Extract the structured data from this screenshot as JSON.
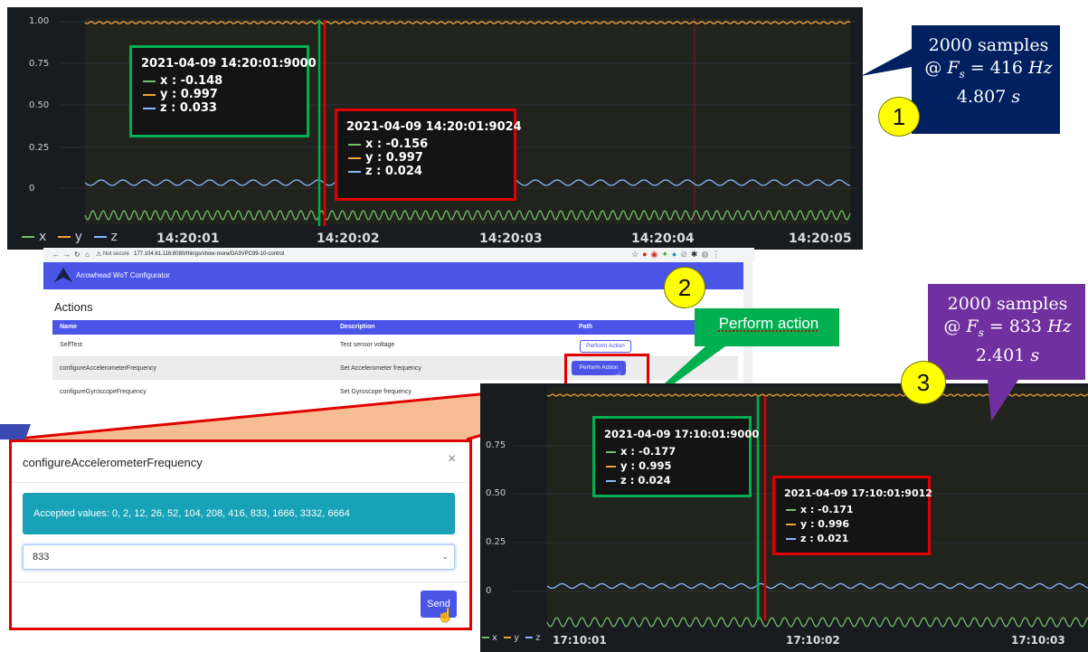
{
  "chart1": {
    "y_ticks": [
      "1.00",
      "0.75",
      "0.50",
      "0.25",
      "0"
    ],
    "x_ticks": [
      "14:20:01",
      "14:20:02",
      "14:20:03",
      "14:20:04",
      "14:20:05"
    ],
    "legend": [
      "x",
      "y",
      "z"
    ],
    "tooltip_a": {
      "timestamp": "2021-04-09 14:20:01:9000",
      "x": "-0.148",
      "y": "0.997",
      "z": "0.033"
    },
    "tooltip_b": {
      "timestamp": "2021-04-09 14:20:01:9024",
      "x": "-0.156",
      "y": "0.997",
      "z": "0.024"
    }
  },
  "chart2": {
    "y_ticks": [
      "0.75",
      "0.50",
      "0.25",
      "0"
    ],
    "x_ticks": [
      "17:10:01",
      "17:10:02",
      "17:10:03"
    ],
    "legend": [
      "x",
      "y",
      "z"
    ],
    "tooltip_a": {
      "timestamp": "2021-04-09 17:10:01:9000",
      "x": "-0.177",
      "y": "0.995",
      "z": "0.024"
    },
    "tooltip_b": {
      "timestamp": "2021-04-09 17:10:01:9012",
      "x": "-0.171",
      "y": "0.996",
      "z": "0.021"
    }
  },
  "series_labels": {
    "x": "x :",
    "y": "y :",
    "z": "z :"
  },
  "callout1": {
    "line1": "2000 samples",
    "line2_prefix": "@ ",
    "fs": "F",
    "sub": "s",
    "line2_suffix": " = 416 ",
    "unit": "Hz",
    "line3": "4.807 ",
    "line3_unit": "s"
  },
  "callout2": {
    "text": "Perform action"
  },
  "callout3": {
    "line1": "2000 samples",
    "line2_prefix": "@ ",
    "fs": "F",
    "sub": "s",
    "line2_suffix": " = 833 ",
    "unit": "Hz",
    "line3": "2.401 ",
    "line3_unit": "s"
  },
  "badges": [
    "1",
    "2",
    "3"
  ],
  "browser": {
    "security": "Not secure",
    "url": "177.104.61.116:8080/things/show-more/DA3VPC99-10-control",
    "app_title": "Arrowhead WoT Configurator",
    "section": "Actions",
    "headers": [
      "Name",
      "Description",
      "Path"
    ],
    "rows": [
      {
        "name": "SelfTest",
        "description": "Test sensor voltage",
        "button": "Perform Action"
      },
      {
        "name": "configureAccelerometerFrequency",
        "description": "Set Accelerometer frequency",
        "button": "Perform Action"
      },
      {
        "name": "configureGyroscopeFrequency",
        "description": "Set Gyroscope frequency",
        "button": ""
      }
    ]
  },
  "modal": {
    "title": "configureAccelerometerFrequency",
    "close": "×",
    "info": "Accepted values: 0, 2, 12, 26, 52, 104, 208, 416, 833, 1666, 3332, 6664",
    "selected": "833",
    "send": "Send"
  },
  "colors": {
    "x": "#73bf69",
    "y": "#f2a33a",
    "z": "#8ab8ff",
    "highlight_green": "#00b050",
    "highlight_red": "#e00000",
    "callout_blue": "#002060",
    "callout_green": "#00b050",
    "callout_purple": "#7030a0",
    "accent": "#4a55e8",
    "info": "#17a2b8"
  }
}
